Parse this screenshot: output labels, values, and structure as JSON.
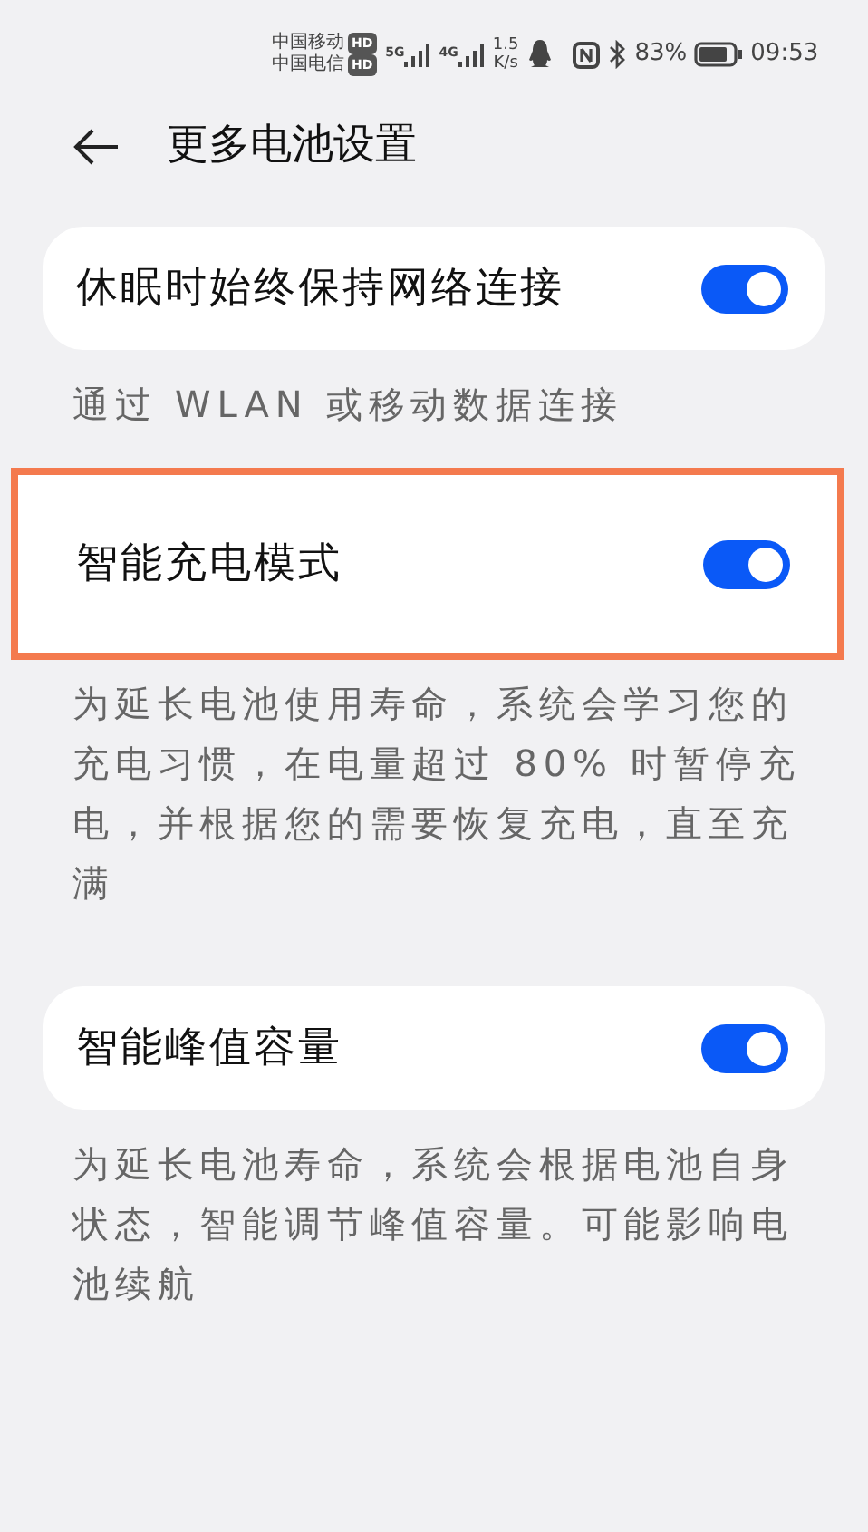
{
  "status_bar": {
    "carriers": [
      {
        "name": "中国移动",
        "badge": "HD"
      },
      {
        "name": "中国电信",
        "badge": "HD"
      }
    ],
    "networks": [
      "5G",
      "4G"
    ],
    "speed": "1.5",
    "speed_unit": "K/s",
    "battery": "83%",
    "time": "09:53"
  },
  "header": {
    "title": "更多电池设置"
  },
  "settings": [
    {
      "label": "休眠时始终保持网络连接",
      "on": true,
      "highlighted": false,
      "description": "通过 WLAN 或移动数据连接"
    },
    {
      "label": "智能充电模式",
      "on": true,
      "highlighted": true,
      "description": "为延长电池使用寿命，系统会学习您的充电习惯，在电量超过 80% 时暂停充电，并根据您的需要恢复充电，直至充满"
    },
    {
      "label": "智能峰值容量",
      "on": true,
      "highlighted": false,
      "description": "为延长电池寿命，系统会根据电池自身状态，智能调节峰值容量。可能影响电池续航"
    }
  ]
}
